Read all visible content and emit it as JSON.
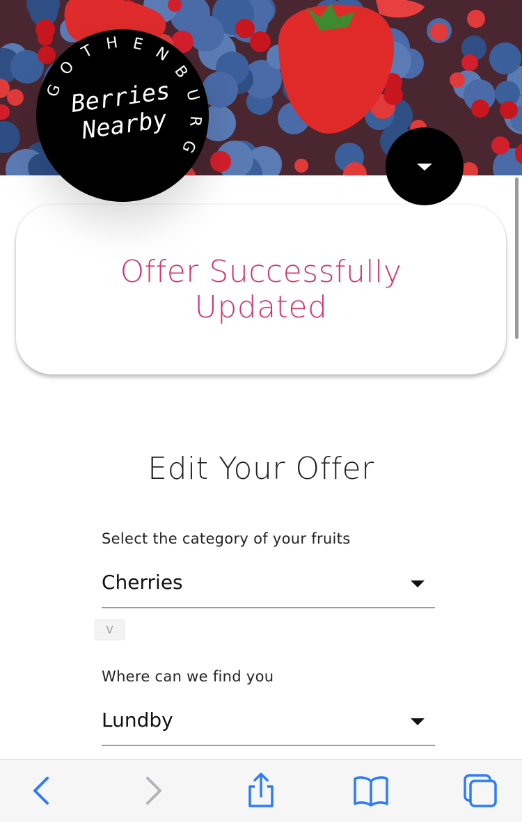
{
  "logo": {
    "title_line1": "Berries",
    "title_line2": "Nearby",
    "ring_text": "GOTHENBURG"
  },
  "hero": {
    "image": "mixed berries photo (strawberries, blueberries, red currants, blackberries)"
  },
  "menu_button": {
    "icon": "caret-down-icon"
  },
  "success_card": {
    "message": "Offer Successfully Updated"
  },
  "form": {
    "title": "Edit Your Offer",
    "category": {
      "label": "Select the category of your fruits",
      "value": "Cherries"
    },
    "location": {
      "label": "Where can we find you",
      "value": "Lundby"
    },
    "toggle_glyph": "V"
  },
  "toolbar": {
    "back_icon": "chevron-left-icon",
    "forward_icon": "chevron-right-icon",
    "share_icon": "share-icon",
    "bookmarks_icon": "book-icon",
    "tabs_icon": "tabs-icon"
  },
  "colors": {
    "accent": "#d3326c",
    "ios_blue": "#2f7cf6",
    "disabled": "#b5b5b9"
  }
}
